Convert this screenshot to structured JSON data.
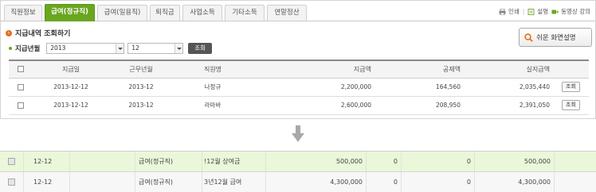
{
  "tabs": [
    {
      "label": "직원정보",
      "active": false
    },
    {
      "label": "급여(정규직)",
      "active": true
    },
    {
      "label": "급여(일용직)",
      "active": false
    },
    {
      "label": "퇴직금",
      "active": false
    },
    {
      "label": "사업소득",
      "active": false
    },
    {
      "label": "기타소득",
      "active": false
    },
    {
      "label": "연말정산",
      "active": false
    }
  ],
  "tools": {
    "print": "인쇄",
    "guide": "설명",
    "video": "동영상 강의"
  },
  "query": {
    "title": "지급내역 조회하기",
    "period_label": "지급년월",
    "year": "2013",
    "month": "12",
    "search_button": "조회"
  },
  "help_button": "쉬운 화면설명",
  "table": {
    "headers": [
      "지급일",
      "근무년월",
      "직원명",
      "지급액",
      "공제액",
      "실지급액"
    ],
    "rows": [
      {
        "pay_date": "2013-12-12",
        "work_month": "2013-12",
        "name": "나정규",
        "gross": "2,200,000",
        "deduction": "164,560",
        "net": "2,035,440",
        "action": "조회"
      },
      {
        "pay_date": "2013-12-12",
        "work_month": "2013-12",
        "name": "라마바",
        "gross": "2,600,000",
        "deduction": "208,950",
        "net": "2,391,050",
        "action": "조회"
      }
    ]
  },
  "bottom_rows": [
    {
      "date": "12-12",
      "type": "급여(정규직)",
      "desc": "!12월 상여금",
      "amount": "500,000",
      "v1": "0",
      "v2": "0",
      "total": "500,000"
    },
    {
      "date": "12-12",
      "type": "급여(정규직)",
      "desc": "3년12월 급여",
      "amount": "4,300,000",
      "v1": "0",
      "v2": "0",
      "total": "4,300,000"
    }
  ],
  "colors": {
    "accent": "#6aa61f",
    "orange": "#e3701f",
    "highlight_row": "#eaf7d9"
  }
}
